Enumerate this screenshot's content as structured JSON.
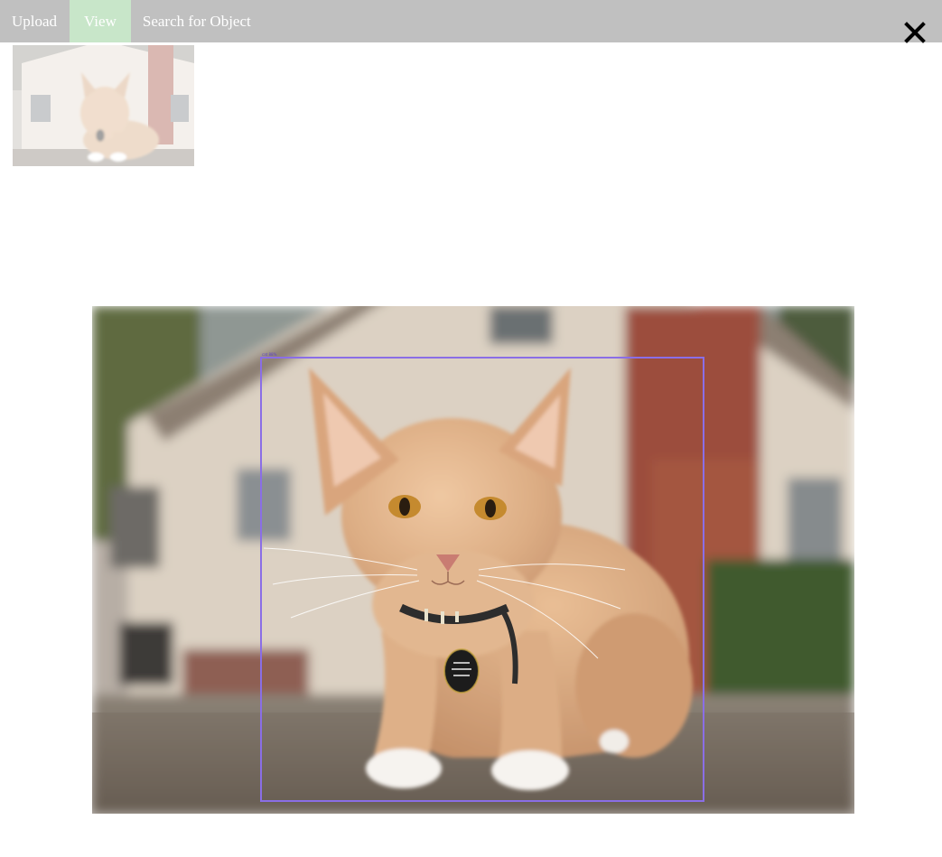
{
  "nav": {
    "tabs": [
      {
        "label": "Upload",
        "active": false
      },
      {
        "label": "View",
        "active": true
      },
      {
        "label": "Search for Object",
        "active": false
      }
    ],
    "active_color": "#c8e6c9",
    "bar_color": "#c0c0c0"
  },
  "icons": {
    "close": "close-icon"
  },
  "viewer": {
    "image_subject": "cat-photo",
    "bbox_color": "#8a6ee6",
    "bbox_label": "cat 88%"
  }
}
